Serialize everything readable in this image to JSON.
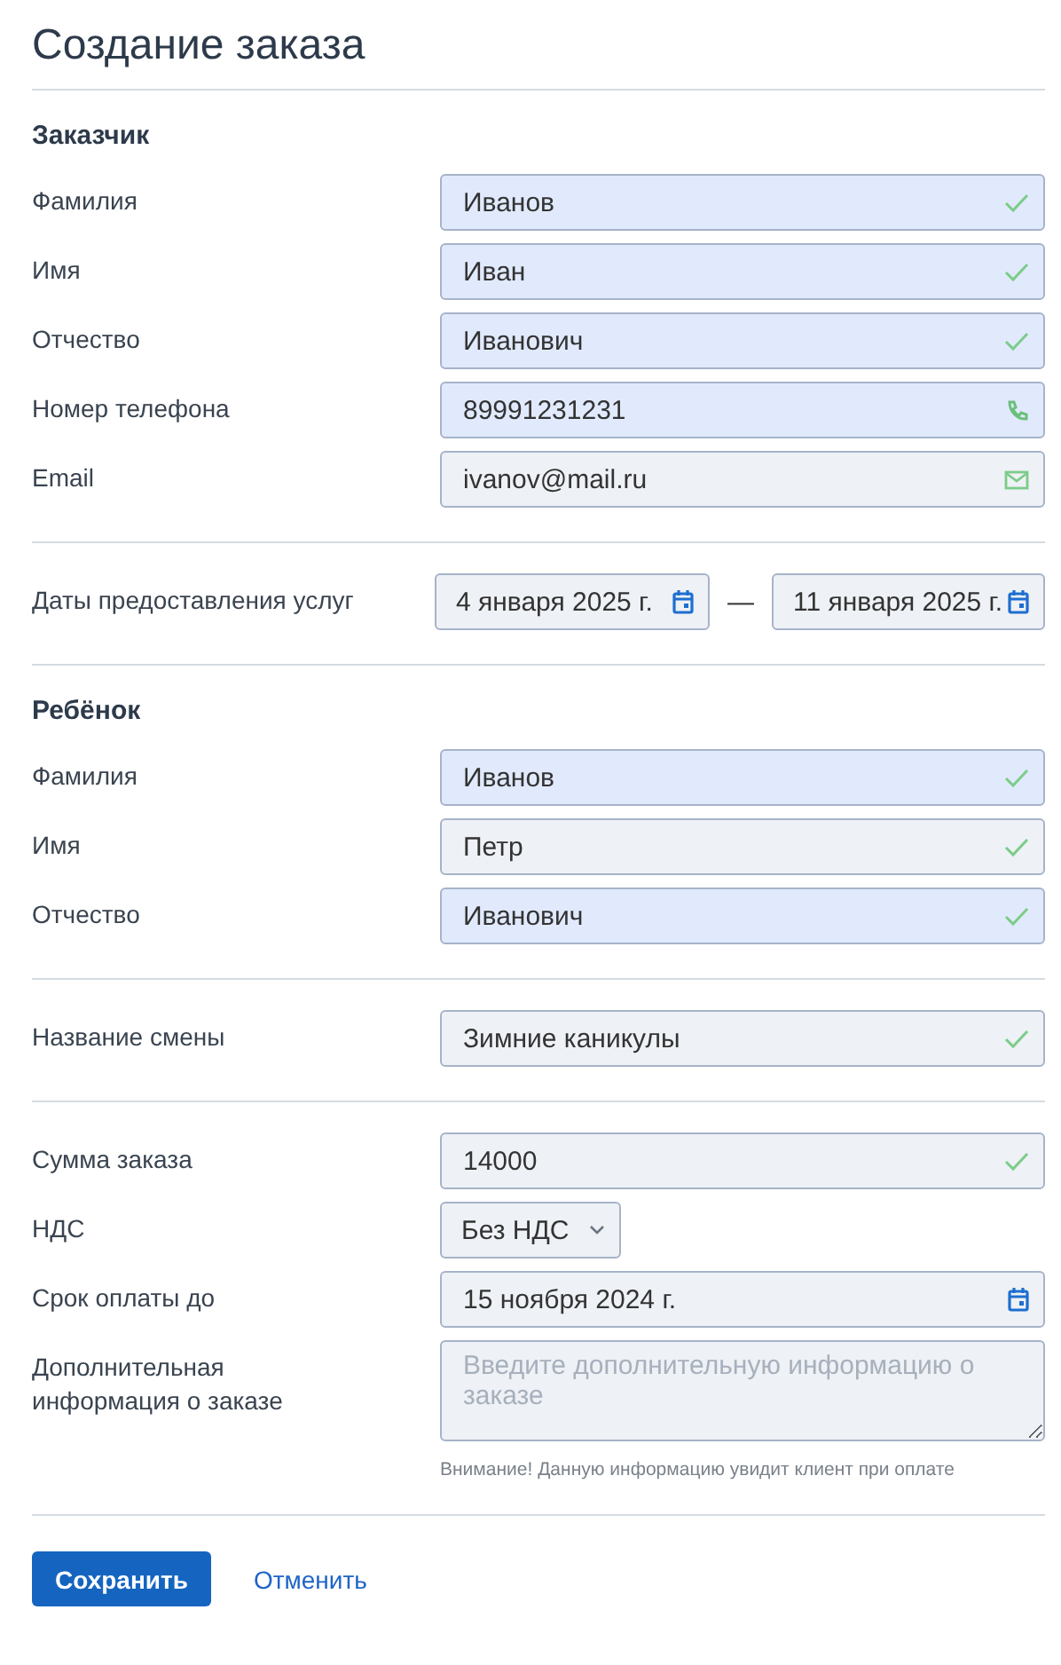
{
  "title": "Создание заказа",
  "sections": [
    {
      "heading": "Заказчик",
      "rows": [
        {
          "kind": "text",
          "label": "Фамилия",
          "value": "Иванов",
          "highlighted": true
        },
        {
          "kind": "text",
          "label": "Имя",
          "value": "Иван",
          "highlighted": true
        },
        {
          "kind": "text",
          "label": "Отчество",
          "value": "Иванович",
          "highlighted": true
        },
        {
          "kind": "phone",
          "label": "Номер телефона",
          "value": "89991231231",
          "highlighted": true
        },
        {
          "kind": "email",
          "label": "Email",
          "value": "ivanov@mail.ru",
          "highlighted": false
        }
      ]
    },
    {
      "rows": [
        {
          "kind": "daterange",
          "label": "Даты предоставления услуг",
          "from": "4 января 2025 г.",
          "separator": "—",
          "to": "11 января 2025 г."
        }
      ]
    },
    {
      "heading": "Ребёнок",
      "rows": [
        {
          "kind": "text",
          "label": "Фамилия",
          "value": "Иванов",
          "highlighted": true
        },
        {
          "kind": "text",
          "label": "Имя",
          "value": "Петр",
          "highlighted": false
        },
        {
          "kind": "text",
          "label": "Отчество",
          "value": "Иванович",
          "highlighted": true
        }
      ]
    },
    {
      "rows": [
        {
          "kind": "text",
          "label": "Название смены",
          "value": "Зимние каникулы",
          "highlighted": false
        }
      ]
    },
    {
      "rows": [
        {
          "kind": "text",
          "label": "Сумма заказа",
          "value": "14000",
          "highlighted": false
        },
        {
          "kind": "select",
          "label": "НДС",
          "value": "Без НДС"
        },
        {
          "kind": "date",
          "label": "Срок оплаты до",
          "value": "15 ноября 2024 г."
        },
        {
          "kind": "textarea",
          "label": "Дополнительная информация о заказе",
          "placeholder": "Введите дополнительную информацию о заказе",
          "note": "Внимание! Данную информацию увидит клиент при оплате"
        }
      ]
    }
  ],
  "buttons": {
    "primary": "Сохранить",
    "secondary": "Отменить"
  }
}
